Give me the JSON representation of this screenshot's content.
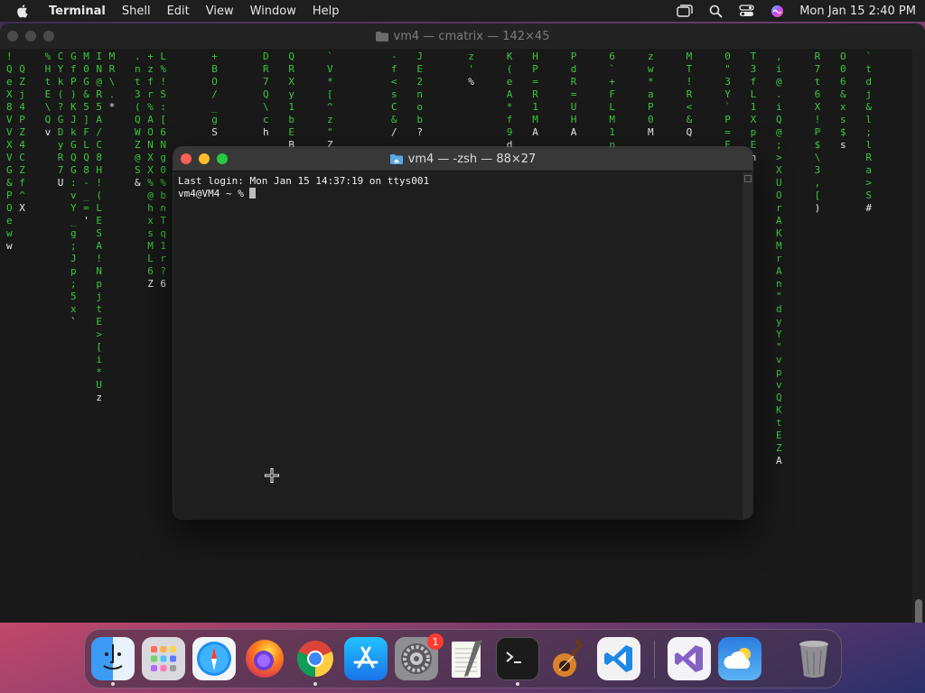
{
  "menubar": {
    "app_name": "Terminal",
    "items": [
      "Shell",
      "Edit",
      "View",
      "Window",
      "Help"
    ],
    "clock": "Mon Jan 15  2:40 PM",
    "status_icons": [
      "window-icon",
      "search-icon",
      "control-center-icon",
      "siri-icon"
    ]
  },
  "background_window": {
    "title": "vm4 — cmatrix — 142×45",
    "matrix_color": "#38c83a",
    "matrix_columns": [
      {
        "col": 0,
        "start": 0,
        "chars": "!QeX8VVXVG&POeww"
      },
      {
        "col": 1,
        "start": 1,
        "chars": "QZj4PZ4CZf^X"
      },
      {
        "col": 3,
        "start": 0,
        "chars": "%HtE\\Qv"
      },
      {
        "col": 4,
        "start": 0,
        "chars": "CYk(?GDyR7U"
      },
      {
        "col": 5,
        "start": 0,
        "chars": "GfP)KJkGQG:vY_g;Jp;5x`"
      },
      {
        "col": 6,
        "start": 0,
        "chars": "M0G&5]FLQ8-_='"
      },
      {
        "col": 7,
        "start": 0,
        "chars": "IN@R5A/C8H!(LESA!NpjtE>[i*Uz"
      },
      {
        "col": 8,
        "start": 0,
        "chars": "MR\\.*"
      },
      {
        "col": 10,
        "start": 0,
        "chars": ".nt3(QWZ@S&"
      },
      {
        "col": 11,
        "start": 0,
        "chars": "+zfr%AONXX%@hxsML6Z"
      },
      {
        "col": 12,
        "start": 0,
        "chars": "L%!S:[6Ng0%bnTq1r?6"
      },
      {
        "col": 16,
        "start": 0,
        "chars": "+BO/_gS"
      },
      {
        "col": 20,
        "start": 0,
        "chars": "DR7Q\\ch"
      },
      {
        "col": 22,
        "start": 0,
        "chars": "QRXy1bEB"
      },
      {
        "col": 25,
        "start": 0,
        "chars": "`V*[^z\"Z"
      },
      {
        "col": 30,
        "start": 0,
        "chars": "-f<sC&/"
      },
      {
        "col": 32,
        "start": 0,
        "chars": "JE2nob?"
      },
      {
        "col": 36,
        "start": 0,
        "chars": "z'%"
      },
      {
        "col": 39,
        "start": 0,
        "chars": "K(eA*f9d"
      },
      {
        "col": 41,
        "start": 0,
        "chars": "HP=R1MA"
      },
      {
        "col": 44,
        "start": 0,
        "chars": "PdR=UHA"
      },
      {
        "col": 47,
        "start": 0,
        "chars": "6`+FLM1pB"
      },
      {
        "col": 50,
        "start": 0,
        "chars": "zw*aP0M"
      },
      {
        "col": 53,
        "start": 0,
        "chars": "MT!R<&Q"
      },
      {
        "col": 56,
        "start": 0,
        "chars": "0\"3Y`P=E8"
      },
      {
        "col": 58,
        "start": 0,
        "chars": "T3fL1XpEn"
      },
      {
        "col": 60,
        "start": 0,
        "chars": ",i@.iQ@;>XUOrAKMrAn\"dyY\"vpvQKtEZA"
      },
      {
        "col": 63,
        "start": 0,
        "chars": "R7t6X!P$\\3,[)"
      },
      {
        "col": 65,
        "start": 0,
        "chars": "O06&xs$s"
      },
      {
        "col": 67,
        "start": 0,
        "chars": "`tdj&l;lRa>S#"
      }
    ]
  },
  "terminal": {
    "title": "vm4 — -zsh — 88×27",
    "lines": [
      "Last login: Mon Jan 15 14:37:19 on ttys001",
      "vm4@VM4 ~ % "
    ]
  },
  "dock": {
    "items": [
      {
        "name": "Finder",
        "icon": "finder-icon",
        "running": true
      },
      {
        "name": "Launchpad",
        "icon": "launchpad-icon",
        "running": false
      },
      {
        "name": "Safari",
        "icon": "safari-icon",
        "running": false
      },
      {
        "name": "Firefox",
        "icon": "firefox-icon",
        "running": false
      },
      {
        "name": "Google Chrome",
        "icon": "chrome-icon",
        "running": true
      },
      {
        "name": "App Store",
        "icon": "app-store-icon",
        "running": false
      },
      {
        "name": "System Settings",
        "icon": "settings-icon",
        "running": false,
        "badge": "1"
      },
      {
        "name": "TextEdit",
        "icon": "textedit-icon",
        "running": false
      },
      {
        "name": "Terminal",
        "icon": "terminal-icon",
        "running": true
      },
      {
        "name": "GarageBand",
        "icon": "garageband-icon",
        "running": false
      },
      {
        "name": "Visual Studio Code",
        "icon": "vscode-icon",
        "running": false
      },
      {
        "name": "Visual Studio",
        "icon": "visual-studio-icon",
        "running": false
      },
      {
        "name": "Weather",
        "icon": "weather-icon",
        "running": false
      },
      {
        "name": "Trash",
        "icon": "trash-icon",
        "running": false
      }
    ]
  }
}
